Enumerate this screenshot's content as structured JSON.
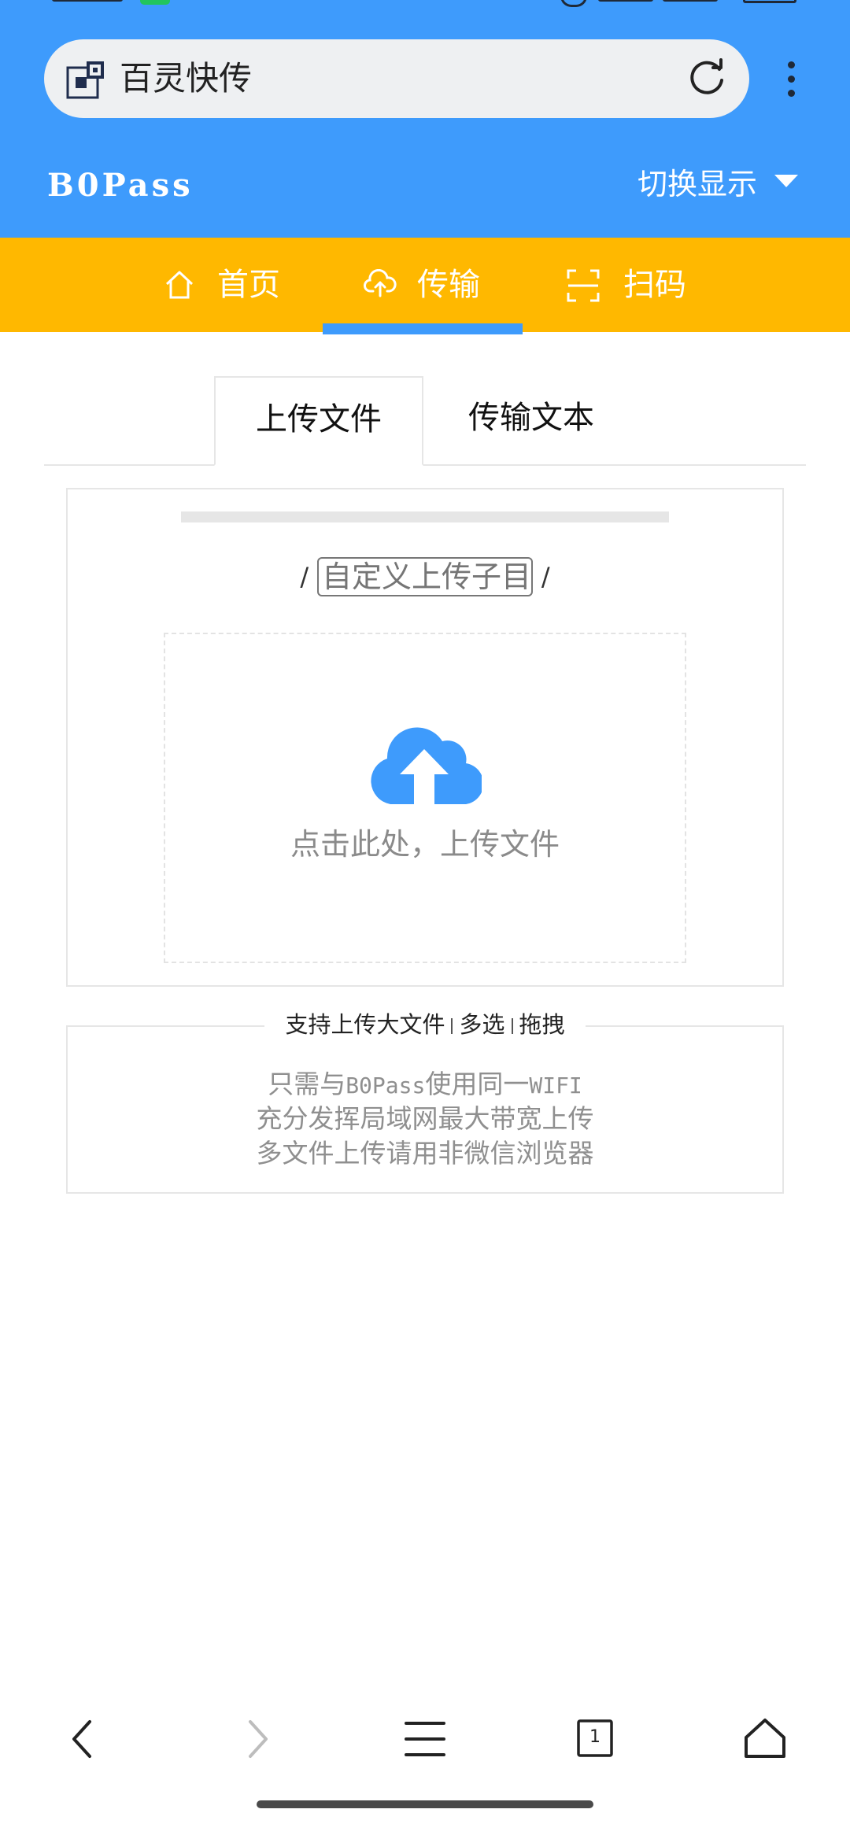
{
  "browser": {
    "address_text": "百灵快传",
    "menu_icon": "kebab-menu-icon"
  },
  "header": {
    "brand": "B0Pass",
    "switch_display": "切换显示"
  },
  "nav": {
    "items": [
      {
        "label": "首页",
        "icon": "home-icon"
      },
      {
        "label": "传输",
        "icon": "cloud-upload-icon",
        "active": true
      },
      {
        "label": "扫码",
        "icon": "scan-icon"
      }
    ]
  },
  "tabs": {
    "upload": "上传文件",
    "text": "传输文本",
    "active": "upload"
  },
  "upload": {
    "slash_left": "/",
    "slash_right": "/",
    "subdir_placeholder": "自定义上传子目",
    "drop_text": "点击此处，上传文件"
  },
  "info": {
    "legend_parts": [
      "支持上传大文件",
      "多选",
      "拖拽"
    ],
    "line1_pre": "只需与",
    "line1_mono1": "B0Pass",
    "line1_mid": "使用同一",
    "line1_mono2": "WIFI",
    "line2": "充分发挥局域网最大带宽上传",
    "line3": "多文件上传请用非微信浏览器"
  },
  "bottom_nav": {
    "tab_count": "1"
  },
  "colors": {
    "primary_blue": "#3e9bfc",
    "nav_yellow": "#ffb800"
  }
}
